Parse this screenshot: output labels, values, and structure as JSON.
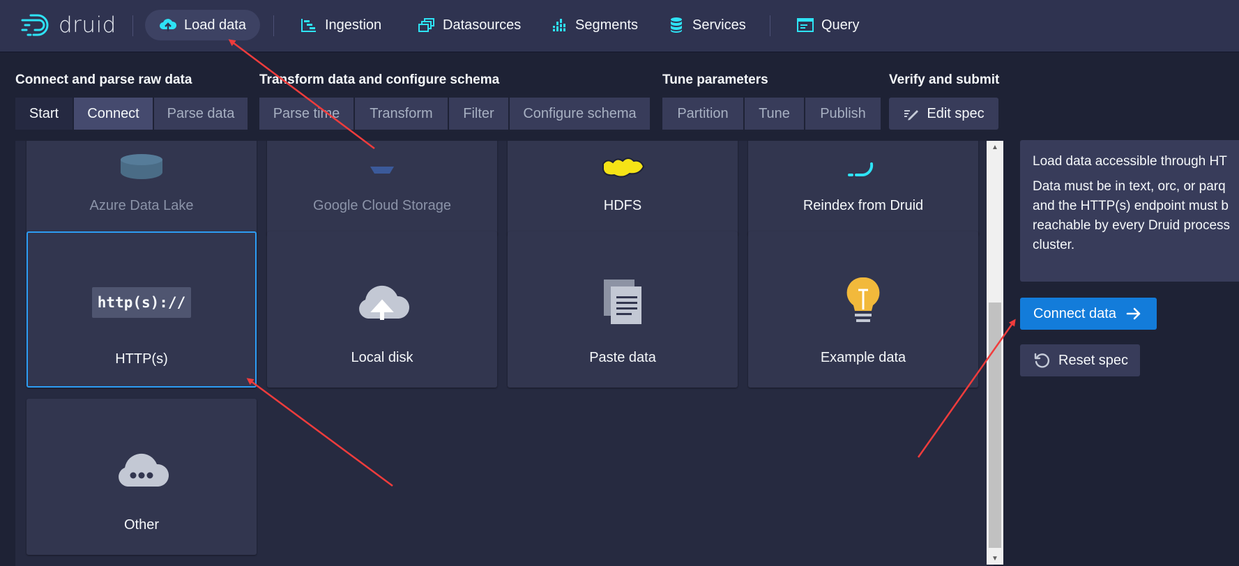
{
  "app": {
    "logo_text": "druid"
  },
  "nav": {
    "load_data": "Load data",
    "ingestion": "Ingestion",
    "datasources": "Datasources",
    "segments": "Segments",
    "services": "Services",
    "query": "Query"
  },
  "steps": {
    "connect_group": {
      "title": "Connect and parse raw data",
      "items": [
        "Start",
        "Connect",
        "Parse data"
      ]
    },
    "transform_group": {
      "title": "Transform data and configure schema",
      "items": [
        "Parse time",
        "Transform",
        "Filter",
        "Configure schema"
      ]
    },
    "tune_group": {
      "title": "Tune parameters",
      "items": [
        "Partition",
        "Tune",
        "Publish"
      ]
    },
    "verify_group": {
      "title": "Verify and submit",
      "items": [
        "Edit spec"
      ]
    }
  },
  "tiles": [
    {
      "label": "Azure Data Lake",
      "icon": "azure-icon",
      "state": "disabled"
    },
    {
      "label": "Google Cloud Storage",
      "icon": "gcs-icon",
      "state": "disabled"
    },
    {
      "label": "HDFS",
      "icon": "hdfs-icon",
      "state": "enabled"
    },
    {
      "label": "Reindex from Druid",
      "icon": "druid-icon",
      "state": "enabled"
    },
    {
      "label": "HTTP(s)",
      "icon": "http-icon",
      "icon_text": "http(s)://",
      "state": "selected"
    },
    {
      "label": "Local disk",
      "icon": "cloud-upload-icon",
      "state": "enabled"
    },
    {
      "label": "Paste data",
      "icon": "paste-icon",
      "state": "enabled"
    },
    {
      "label": "Example data",
      "icon": "lightbulb-icon",
      "state": "enabled"
    },
    {
      "label": "Other",
      "icon": "cloud-more-icon",
      "state": "enabled"
    }
  ],
  "info": {
    "p1": "Load data accessible through HT",
    "p2_lines": [
      "Data must be in text, orc, or parq",
      "and the HTTP(s) endpoint must b",
      "reachable by every Druid process",
      "cluster."
    ]
  },
  "actions": {
    "connect_data": "Connect data",
    "reset_spec": "Reset spec"
  },
  "colors": {
    "background": "#1e2235",
    "navbar": "#2f3350",
    "accent_blue": "#137cda",
    "selected_border": "#2d9df4",
    "icon_cyan": "#2ee3f5",
    "annotation_red": "#f03c3c"
  }
}
